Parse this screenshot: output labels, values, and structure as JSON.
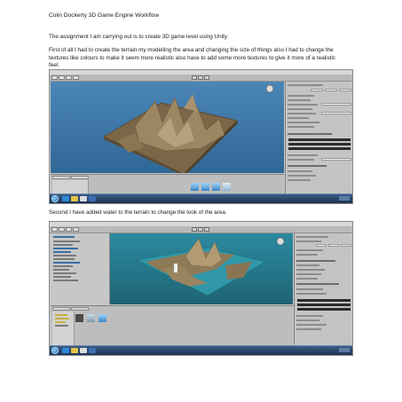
{
  "document": {
    "title": "Colin Dockerty 3D Game Engine Workflow",
    "paragraphs": [
      "The assignment I am carrying out is to create 3D game level using Unity.",
      "First of all I had to create the terrain my modelling the area and changing the size of things also I had to change the textures like colours to make it seem more realistic also have to add some more textures to give it more of a realistic feel.",
      "Second I have added water to the terrain to change the look of the area."
    ]
  },
  "screenshots": [
    {
      "name": "unity-terrain-editor",
      "viewport_color": "#3f77a8",
      "terrain_color": "#8f7a58"
    },
    {
      "name": "unity-terrain-with-water",
      "viewport_color": "#2f7f92",
      "terrain_color": "#a48c66",
      "water_color": "#2e8ea0"
    }
  ]
}
